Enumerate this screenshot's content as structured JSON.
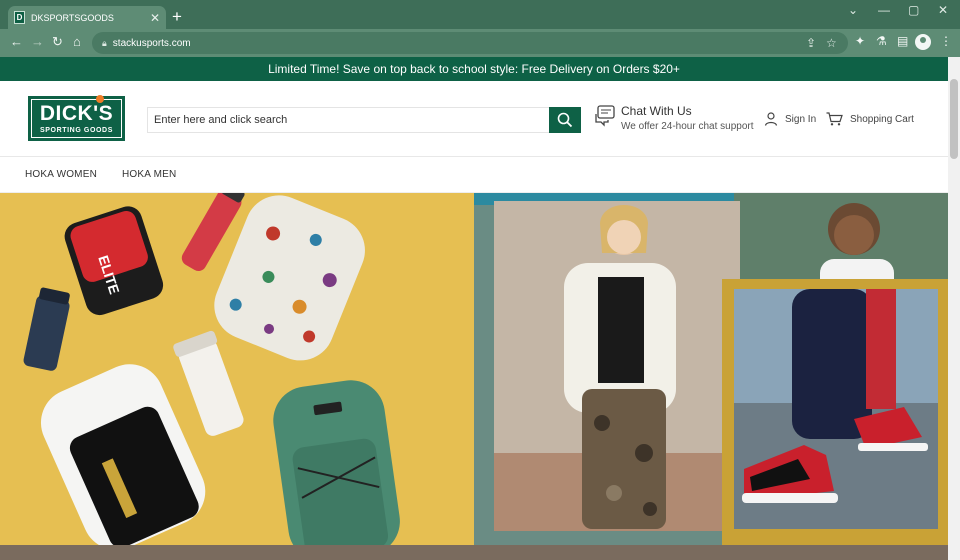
{
  "browser": {
    "tab_title": "DKSPORTSGOODS",
    "favicon_letter": "D",
    "url": "stackusports.com",
    "theme_color": "#3e6e58"
  },
  "promo_banner": {
    "text": "Limited Time!  Save on top back to school style: Free Delivery on Orders $20+",
    "background": "#0e6146"
  },
  "header": {
    "logo_main": "DICK'S",
    "logo_sub": "SPORTING GOODS",
    "search_placeholder": "Enter here and click search",
    "chat_title": "Chat With Us",
    "chat_subtitle": "We offer 24-hour chat support",
    "signin_label": "Sign In",
    "cart_label": "Shopping Cart",
    "brand_color": "#0e6146"
  },
  "category_nav": [
    {
      "label": "HOKA WOMEN"
    },
    {
      "label": "HOKA MEN"
    }
  ],
  "hero": {
    "left_panel_color": "#e6bf52",
    "left_panel_contents": [
      "red lunch cooler",
      "red water bottle",
      "floral backpack",
      "navy tumbler",
      "white straw tumbler",
      "white and black backpack",
      "green backpack"
    ],
    "right_panel_contents": [
      "girl in white puffer vest",
      "boy in sneakers"
    ]
  }
}
